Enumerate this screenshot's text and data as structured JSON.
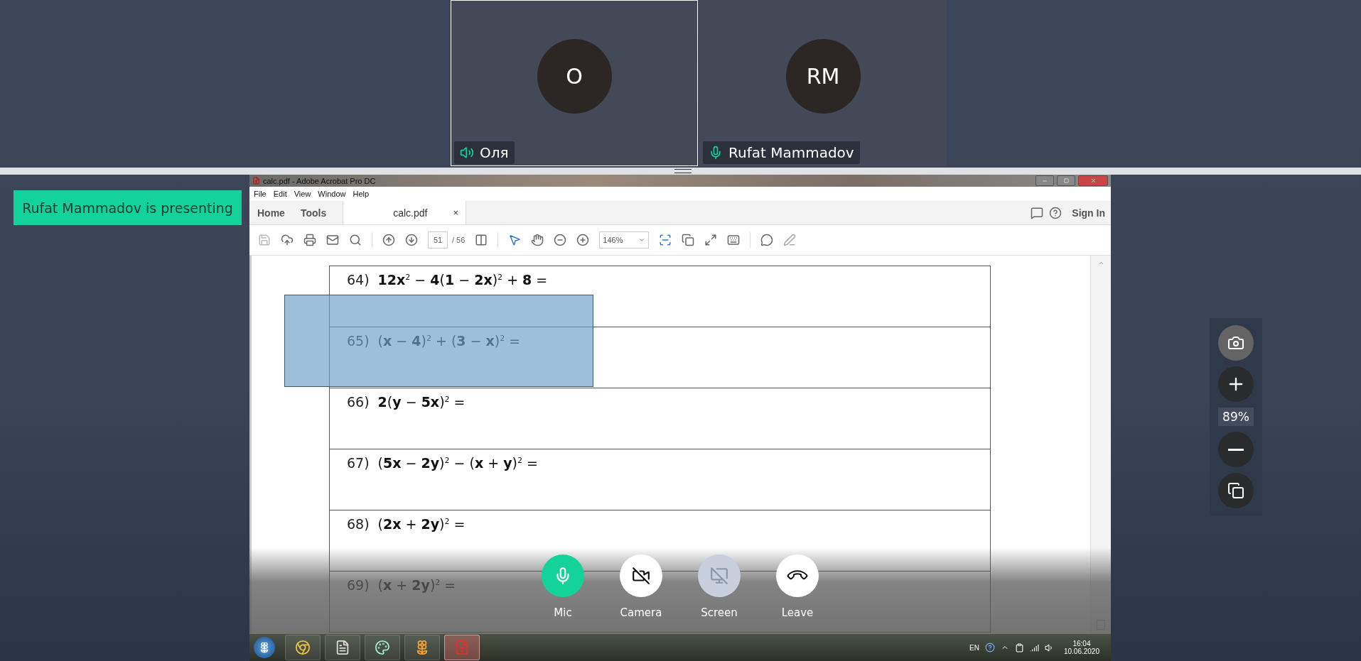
{
  "participants": [
    {
      "initials": "O",
      "name": "Оля",
      "kind": "speaker",
      "selected": true
    },
    {
      "initials": "RM",
      "name": "Rufat Mammadov",
      "kind": "mic",
      "selected": false
    }
  ],
  "banner": "Rufat Mammadov is presenting",
  "shared_window": {
    "title": "calc.pdf - Adobe Acrobat Pro DC",
    "menu": [
      "File",
      "Edit",
      "View",
      "Window",
      "Help"
    ],
    "tabs": [
      {
        "label": "Home",
        "selected": false
      },
      {
        "label": "Tools",
        "selected": false
      },
      {
        "label": "calc.pdf",
        "selected": true,
        "close": "×"
      }
    ],
    "sign_in": "Sign In",
    "toolbar": {
      "page": "51",
      "page_count": "/ 56",
      "zoom": "146%"
    },
    "problems": [
      {
        "number": "64)",
        "expression": "**12x**$^{2}$ − **4**(**1** − **2x**)$^{2}$ + **8** ="
      },
      {
        "number": "65)",
        "expression": "(**x** − **4**)$^{2}$ + (**3** − **x**)$^{2}$ ="
      },
      {
        "number": "66)",
        "expression": "**2**(**y** − **5x**)$^{2}$ ="
      },
      {
        "number": "67)",
        "expression": "(**5x** − **2y**)$^{2}$ − (**x** + **y**)$^{2}$ ="
      },
      {
        "number": "68)",
        "expression": "(**2x** + **2y**)$^{2}$ ="
      },
      {
        "number": "69)",
        "expression": "(**x** + **2y**)$^{2}$ ="
      }
    ],
    "taskbar": {
      "apps": [
        {
          "kind": "chrome",
          "selected": false
        },
        {
          "kind": "document",
          "selected": false
        },
        {
          "kind": "paint",
          "selected": false
        },
        {
          "kind": "flower",
          "selected": false
        },
        {
          "kind": "acrobat",
          "selected": true
        }
      ],
      "language": "EN",
      "time": "16:04",
      "date": "10.06.2020"
    }
  },
  "call_controls": [
    {
      "kind": "mic",
      "label": "Mic",
      "on": true,
      "disabled": false
    },
    {
      "kind": "camera",
      "label": "Camera",
      "on": false,
      "disabled": false
    },
    {
      "kind": "screen",
      "label": "Screen",
      "on": false,
      "disabled": true
    },
    {
      "kind": "leave",
      "label": "Leave",
      "on": false,
      "disabled": false
    }
  ],
  "view_controls": {
    "zoom": "89%"
  }
}
